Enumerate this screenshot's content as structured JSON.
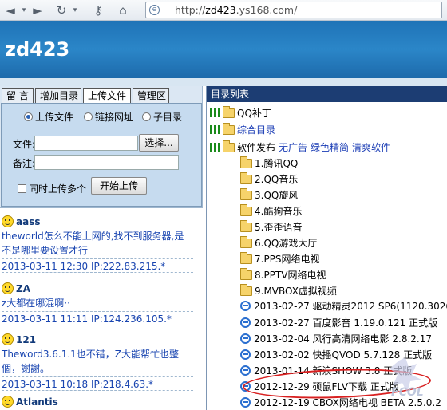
{
  "browser": {
    "address_prefix": "http://",
    "address_host": "zd423",
    "address_rest": ".ys168.com/"
  },
  "site": {
    "title": "zd423"
  },
  "tabs": [
    "留 言",
    "增加目录",
    "上传文件",
    "管理区"
  ],
  "upload": {
    "radios": [
      "上传文件",
      "链接网址",
      "子目录"
    ],
    "file_label": "文件:",
    "note_label": "备注:",
    "browse_button": "选择...",
    "multi_checkbox": "同时上传多个",
    "start_button": "开始上传"
  },
  "messages": [
    {
      "name": "aass",
      "body": "theworld怎么不能上网的,找不到服务器,是不是哪里要设置才行",
      "meta": "2013-03-11 12:30 IP:222.83.215.*"
    },
    {
      "name": "ZA",
      "body": "z大都在哪混啊··",
      "meta": "2013-03-11 11:11 IP:124.236.105.*"
    },
    {
      "name": "121",
      "body": "Theword3.6.1.1也不错，Z大能帮忙也整個，謝謝。",
      "meta": "2013-03-11 10:18 IP:218.4.63.*"
    },
    {
      "name": "Atlantis"
    }
  ],
  "directory": {
    "header": "目录列表",
    "top": [
      "QQ补丁",
      "综合目录"
    ],
    "software": {
      "label": "软件发布",
      "tags": [
        "无广告",
        "绿色精简",
        "清爽软件"
      ]
    },
    "folders": [
      "1.腾讯QQ",
      "2.QQ音乐",
      "3.QQ旋风",
      "4.酷狗音乐",
      "5.歪歪语音",
      "6.QQ游戏大厅",
      "7.PPS网络电视",
      "8.PPTV网络电视",
      "9.MVBOX虚拟视频"
    ],
    "files": [
      "2013-02-27 驱动精灵2012 SP6(1120.3026)",
      "2013-02-27 百度影音 1.19.0.121 正式版",
      "2013-02-04 风行高清网络电影 2.8.2.17",
      "2013-02-02 快播QVOD 5.7.128 正式版",
      "2013-01-14 新浪SHOW 3.8 正式版",
      "2012-12-29 硕鼠FLV下载 正式版",
      "2012-12-19 CBOX网络电视 BETA 2.5.0.2"
    ]
  }
}
